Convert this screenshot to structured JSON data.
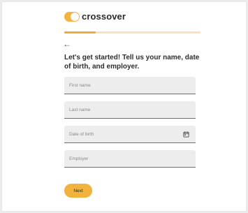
{
  "brand": {
    "name": "crossover",
    "accent_color": "#f4b23f"
  },
  "progress": {
    "fraction": 0.23
  },
  "back": {
    "icon": "arrow-left-icon",
    "glyph": "←"
  },
  "heading": "Let's get started! Tell us your name, date of birth, and employer.",
  "form": {
    "first_name": {
      "placeholder": "First name",
      "value": ""
    },
    "last_name": {
      "placeholder": "Last name",
      "value": ""
    },
    "date_of_birth": {
      "placeholder": "Date of birth",
      "value": "",
      "icon": "calendar-icon"
    },
    "employer": {
      "placeholder": "Employer",
      "value": ""
    }
  },
  "next_button": {
    "label": "Next",
    "color": "#f2b33d"
  }
}
